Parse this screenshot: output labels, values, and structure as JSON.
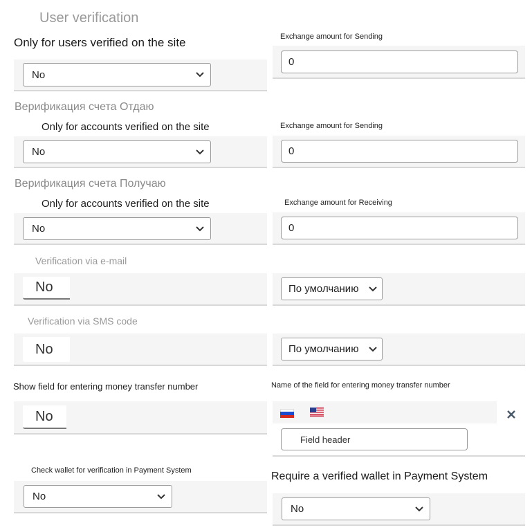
{
  "title": "User verification",
  "left": {
    "user_verified_label": "Only for users verified on the site",
    "user_verified_value": "No",
    "give_section": "Верификация счета Отдаю",
    "give_label": "Only for accounts verified on the site",
    "give_value": "No",
    "get_section": "Верификация счета Получаю",
    "get_label": "Only for accounts verified on the site",
    "get_value": "No",
    "email_label": "Verification via e-mail",
    "email_value": "No",
    "sms_label": "Verification via SMS code",
    "sms_value": "No",
    "transfer_label": "Show field for entering money transfer number",
    "transfer_value": "No",
    "wallet_check_label": "Check wallet for verification in Payment System",
    "wallet_check_value": "No"
  },
  "right": {
    "amount1_label": "Exchange amount for Sending",
    "amount1_value": "0",
    "amount2_label": "Exchange amount for Sending",
    "amount2_value": "0",
    "amount3_label": "Exchange amount for Receiving",
    "amount3_value": "0",
    "email_mode": "По умолчанию",
    "sms_mode": "По умолчанию",
    "field_name_label": "Name of the field for entering money transfer number",
    "field_header_placeholder": "Field header",
    "wallet_required_label": "Require a verified wallet in Payment System",
    "wallet_required_value": "No"
  },
  "icons": {
    "chevron": "chevron-down-icon",
    "close": "close-icon",
    "flag_ru": "flag-ru-icon",
    "flag_us": "flag-us-icon"
  },
  "colors": {
    "border": "#9a9a9a",
    "band": "#f5f5f5",
    "section_text": "#8a8a8a",
    "close_icon": "#4a5a6a"
  }
}
